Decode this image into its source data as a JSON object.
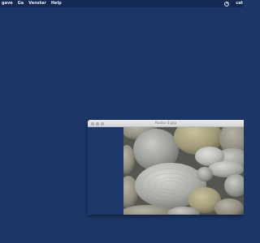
{
  "menubar": {
    "items": [
      "gave",
      "Ga",
      "Venster",
      "Help"
    ],
    "user": "cat"
  },
  "icons": {
    "status": "clock-icon"
  },
  "window": {
    "title": "Rocks-3.jpg",
    "image_description_icon": "photo-icon"
  },
  "colors": {
    "desktop": "#1c3766",
    "menubar": "#142a52"
  }
}
